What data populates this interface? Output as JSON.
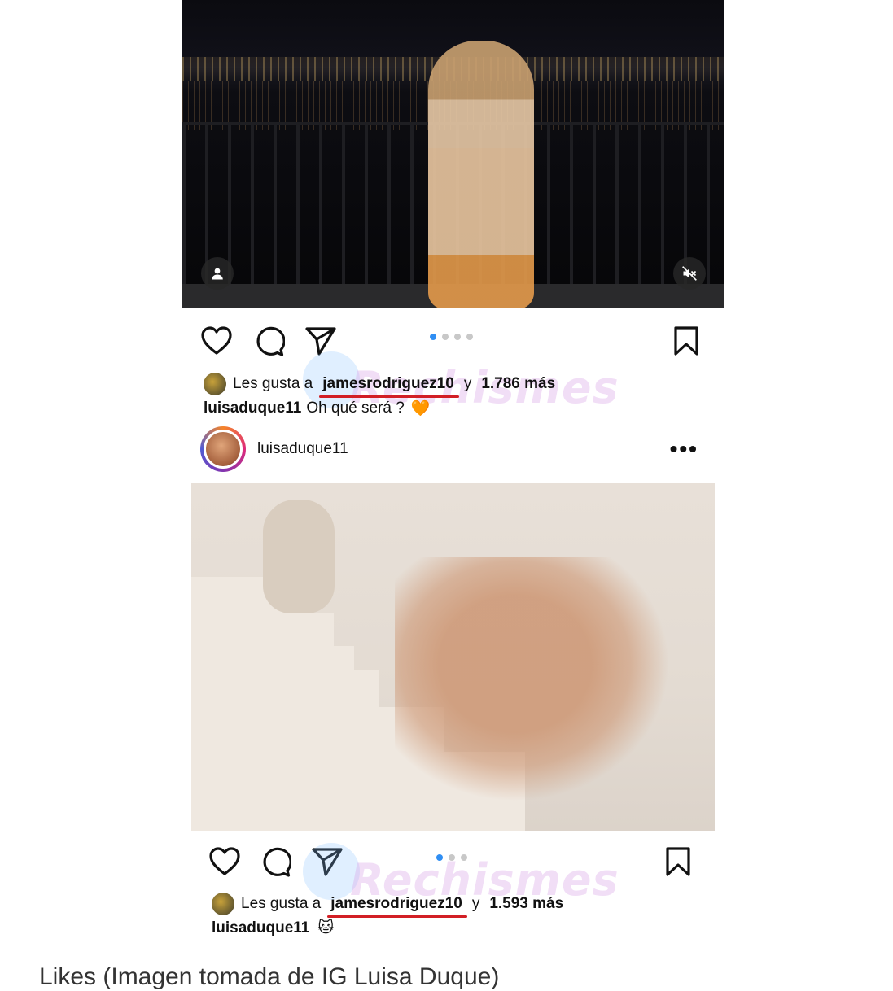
{
  "post1": {
    "likes": {
      "prefix": "Les gusta a",
      "user": "jamesrodriguez10",
      "connector": "y",
      "count": "1.786 más"
    },
    "caption": {
      "user": "luisaduque11",
      "text": "Oh qué será ?",
      "emoji": "🧡"
    },
    "carousel_dots": 4,
    "active_dot": 0
  },
  "post2": {
    "header": {
      "username": "luisaduque11",
      "more": "•••"
    },
    "likes": {
      "prefix": "Les gusta a",
      "user": "jamesrodriguez10",
      "connector": "y",
      "count": "1.593 más"
    },
    "caption": {
      "user": "luisaduque11",
      "emoji": "🐱"
    },
    "carousel_dots": 3,
    "active_dot": 0
  },
  "watermark": "Rechismes",
  "footer_caption": "Likes (Imagen tomada de IG Luisa Duque)",
  "icons": [
    "user-tag-icon",
    "muted-speaker-icon",
    "heart-icon",
    "comment-icon",
    "share-icon",
    "bookmark-icon",
    "more-options-icon"
  ],
  "colors": {
    "mention_underline": "#d21f25",
    "active_dot": "#2f8ef3"
  }
}
